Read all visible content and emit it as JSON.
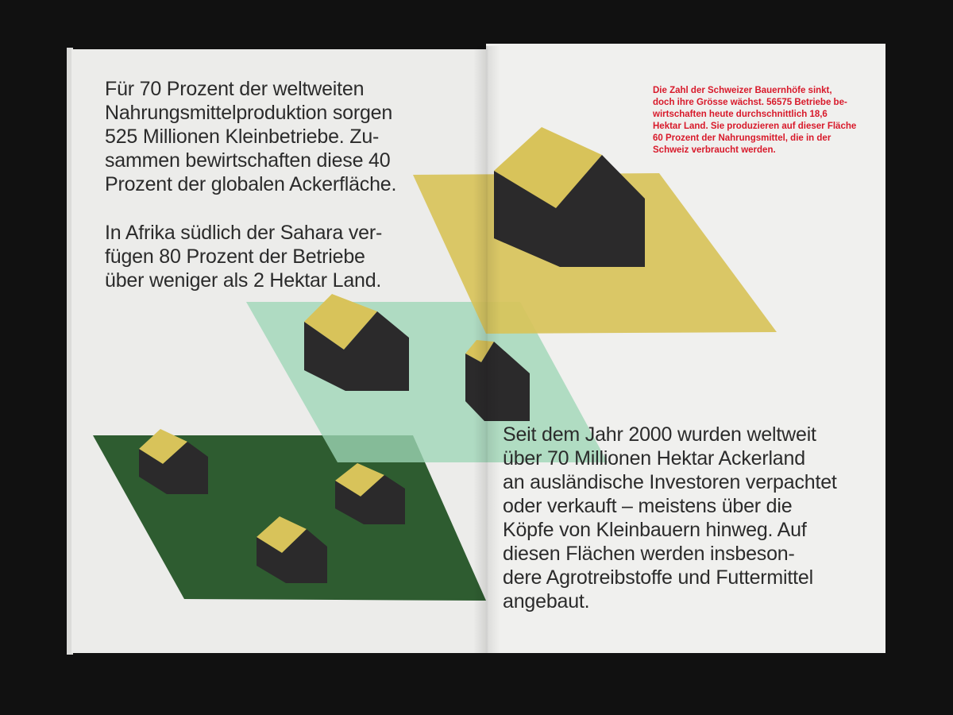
{
  "left_page": {
    "paragraph_1": [
      "Für 70 Prozent der weltweiten",
      "Nahrungsmittelproduktion sorgen",
      "525 Millionen Kleinbetriebe. Zu-",
      "sammen bewirtschaften diese 40",
      "Prozent der globalen Ackerfläche."
    ],
    "paragraph_2": [
      "In Afrika südlich der Sahara ver-",
      "fügen 80 Prozent der Betriebe",
      "über weniger als 2 Hektar Land."
    ]
  },
  "right_page": {
    "red_note": [
      "Die Zahl der Schweizer Bauernhöfe sinkt,",
      "doch ihre Grösse wächst. 56575 Betriebe be-",
      "wirtschaften heute durchschnittlich 18,6",
      "Hektar Land. Sie produzieren auf dieser Fläche",
      "60 Prozent der Nahrungsmittel, die in der",
      "Schweiz verbraucht werden."
    ],
    "paragraph_3": [
      "Seit dem Jahr 2000 wurden weltweit",
      "über 70 Millionen Hektar Ackerland",
      "an ausländische Investoren verpachtet",
      "oder verkauft – meistens über die",
      "Köpfe von Kleinbauern hinweg. Auf",
      "diesen Flächen werden insbeson-",
      "dere Agrotreibstoffe und Futtermittel",
      "angebaut."
    ]
  },
  "colors": {
    "mustard": "#d8c35a",
    "mint": "#9ed6b6",
    "forest": "#2e5c30",
    "house_dark": "#2b2a2b",
    "red": "#d8192a"
  }
}
